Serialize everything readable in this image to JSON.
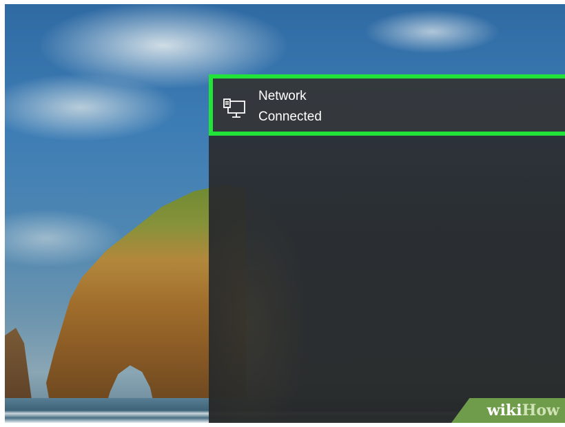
{
  "network_tile": {
    "title": "Network",
    "status": "Connected",
    "icon": "desktop-network-icon",
    "highlight_color": "#22e33a"
  },
  "watermark": {
    "wiki": "wiki",
    "how": "How"
  },
  "colors": {
    "panel_background": "#2b2d30",
    "text": "#ffffff"
  }
}
